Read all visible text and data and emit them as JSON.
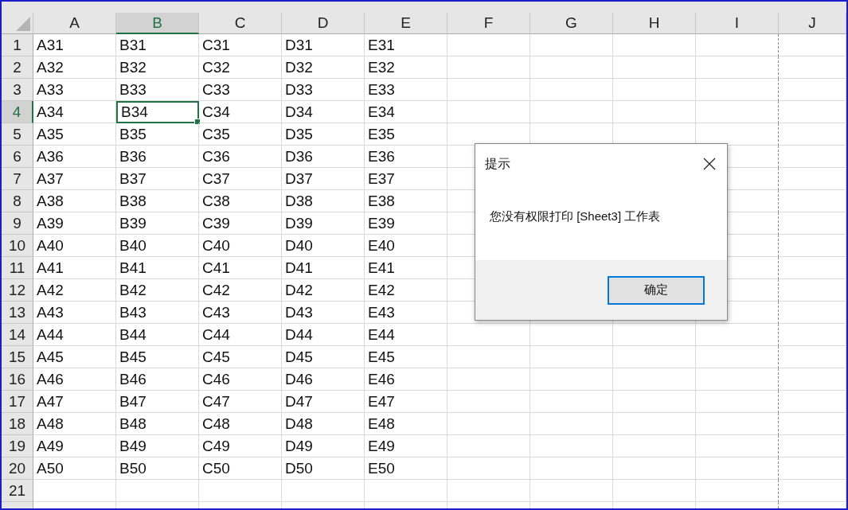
{
  "columns": [
    {
      "label": "A",
      "selected": false,
      "page_break": false
    },
    {
      "label": "B",
      "selected": true,
      "page_break": false
    },
    {
      "label": "C",
      "selected": false,
      "page_break": false
    },
    {
      "label": "D",
      "selected": false,
      "page_break": false
    },
    {
      "label": "E",
      "selected": false,
      "page_break": false
    },
    {
      "label": "F",
      "selected": false,
      "page_break": false
    },
    {
      "label": "G",
      "selected": false,
      "page_break": false
    },
    {
      "label": "H",
      "selected": false,
      "page_break": false
    },
    {
      "label": "I",
      "selected": false,
      "page_break": true
    },
    {
      "label": "J",
      "selected": false,
      "page_break": false
    }
  ],
  "rows": [
    {
      "number": "1",
      "selected": false,
      "cells": [
        "A31",
        "B31",
        "C31",
        "D31",
        "E31"
      ]
    },
    {
      "number": "2",
      "selected": false,
      "cells": [
        "A32",
        "B32",
        "C32",
        "D32",
        "E32"
      ]
    },
    {
      "number": "3",
      "selected": false,
      "cells": [
        "A33",
        "B33",
        "C33",
        "D33",
        "E33"
      ]
    },
    {
      "number": "4",
      "selected": true,
      "cells": [
        "A34",
        "B34",
        "C34",
        "D34",
        "E34"
      ]
    },
    {
      "number": "5",
      "selected": false,
      "cells": [
        "A35",
        "B35",
        "C35",
        "D35",
        "E35"
      ]
    },
    {
      "number": "6",
      "selected": false,
      "cells": [
        "A36",
        "B36",
        "C36",
        "D36",
        "E36"
      ]
    },
    {
      "number": "7",
      "selected": false,
      "cells": [
        "A37",
        "B37",
        "C37",
        "D37",
        "E37"
      ]
    },
    {
      "number": "8",
      "selected": false,
      "cells": [
        "A38",
        "B38",
        "C38",
        "D38",
        "E38"
      ]
    },
    {
      "number": "9",
      "selected": false,
      "cells": [
        "A39",
        "B39",
        "C39",
        "D39",
        "E39"
      ]
    },
    {
      "number": "10",
      "selected": false,
      "cells": [
        "A40",
        "B40",
        "C40",
        "D40",
        "E40"
      ]
    },
    {
      "number": "11",
      "selected": false,
      "cells": [
        "A41",
        "B41",
        "C41",
        "D41",
        "E41"
      ]
    },
    {
      "number": "12",
      "selected": false,
      "cells": [
        "A42",
        "B42",
        "C42",
        "D42",
        "E42"
      ]
    },
    {
      "number": "13",
      "selected": false,
      "cells": [
        "A43",
        "B43",
        "C43",
        "D43",
        "E43"
      ]
    },
    {
      "number": "14",
      "selected": false,
      "cells": [
        "A44",
        "B44",
        "C44",
        "D44",
        "E44"
      ]
    },
    {
      "number": "15",
      "selected": false,
      "cells": [
        "A45",
        "B45",
        "C45",
        "D45",
        "E45"
      ]
    },
    {
      "number": "16",
      "selected": false,
      "cells": [
        "A46",
        "B46",
        "C46",
        "D46",
        "E46"
      ]
    },
    {
      "number": "17",
      "selected": false,
      "cells": [
        "A47",
        "B47",
        "C47",
        "D47",
        "E47"
      ]
    },
    {
      "number": "18",
      "selected": false,
      "cells": [
        "A48",
        "B48",
        "C48",
        "D48",
        "E48"
      ]
    },
    {
      "number": "19",
      "selected": false,
      "cells": [
        "A49",
        "B49",
        "C49",
        "D49",
        "E49"
      ]
    },
    {
      "number": "20",
      "selected": false,
      "cells": [
        "A50",
        "B50",
        "C50",
        "D50",
        "E50"
      ]
    },
    {
      "number": "21",
      "selected": false,
      "cells": []
    }
  ],
  "dialog": {
    "title": "提示",
    "message": "您没有权限打印 [Sheet3] 工作表",
    "ok_button": "确定"
  }
}
